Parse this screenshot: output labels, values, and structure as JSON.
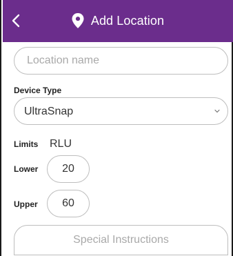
{
  "header": {
    "title": "Add Location",
    "back_icon": "chevron-left-icon",
    "title_icon": "map-pin-icon",
    "background": "#6b2d8c"
  },
  "form": {
    "location_name": {
      "placeholder": "Location name",
      "value": ""
    },
    "device_type": {
      "label": "Device Type",
      "selected": "UltraSnap"
    },
    "limits": {
      "label": "Limits",
      "unit": "RLU"
    },
    "lower": {
      "label": "Lower",
      "value": "20"
    },
    "upper": {
      "label": "Upper",
      "value": "60"
    },
    "special_instructions": {
      "placeholder": "Special Instructions"
    }
  }
}
